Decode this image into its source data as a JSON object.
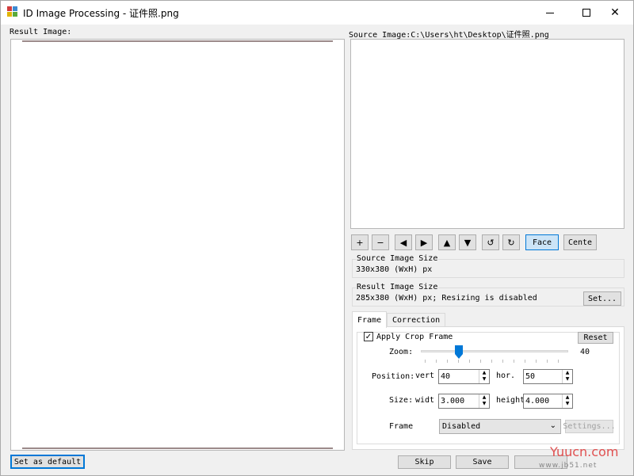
{
  "window": {
    "title": "ID Image Processing - 证件照.png",
    "close_glyph": "✕"
  },
  "result_image": {
    "label": "Result Image:"
  },
  "source_image": {
    "label": "Source Image:C:\\Users\\ht\\Desktop\\证件照.png"
  },
  "toolbar": {
    "zoom_in": "+",
    "zoom_out": "−",
    "move_left": "◀",
    "move_right": "▶",
    "move_up": "▲",
    "move_down": "▼",
    "rotate_left": "↺",
    "rotate_right": "↻",
    "face": "Face",
    "center": "Cente"
  },
  "source_size": {
    "title": "Source Image Size",
    "value": "330x380 (WxH) px"
  },
  "result_size": {
    "title": "Result Image Size",
    "value": "285x380 (WxH) px; Resizing is disabled",
    "set_button": "Set..."
  },
  "tabs": [
    {
      "label": "Frame",
      "selected": true
    },
    {
      "label": "Correction",
      "selected": false
    }
  ],
  "frame": {
    "apply_crop_frame": "Apply Crop Frame",
    "checkmark": "✓",
    "checked": true,
    "reset": "Reset",
    "zoom_label": "Zoom:",
    "zoom_value": "40",
    "position_label": "Position:",
    "vert_label": "vert",
    "vert_value": "40",
    "hor_label": "hor.",
    "hor_value": "50",
    "size_label": "Size:",
    "width_label": "widt",
    "width_value": "3.000",
    "height_label": "height",
    "height_value": "4.000",
    "frame_label": "Frame",
    "frame_select": "Disabled",
    "settings": "Settings..."
  },
  "footer": {
    "set_default": "Set as default",
    "skip": "Skip",
    "save": "Save"
  },
  "watermark": {
    "main": "Yuucn.com",
    "sub": "www.jb51.net"
  },
  "colors": {
    "accent": "#0078d7",
    "window_bg": "#f0f0f0",
    "panel_bg": "#ffffff"
  }
}
